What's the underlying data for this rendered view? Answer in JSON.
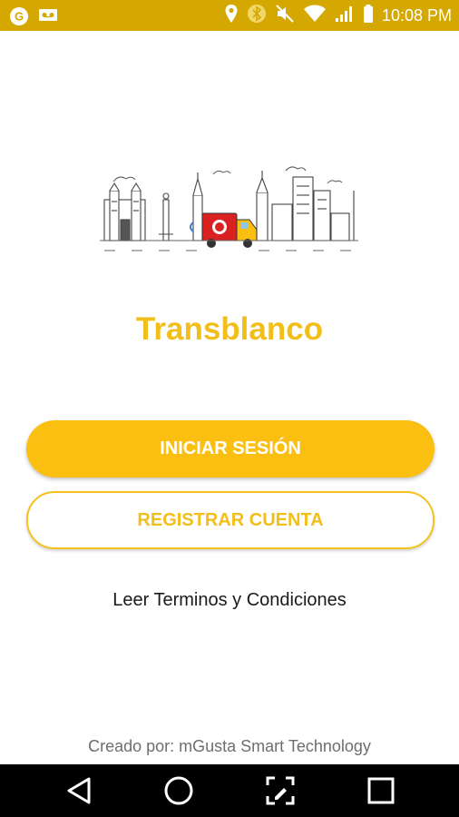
{
  "status_bar": {
    "time": "10:08 PM",
    "icons": [
      "g-app-icon",
      "voicemail-icon",
      "location-icon",
      "bluetooth-icon",
      "mute-icon",
      "wifi-icon",
      "signal-icon",
      "battery-icon"
    ]
  },
  "app": {
    "title": "Transblanco",
    "accent_color": "#fbbf12"
  },
  "actions": {
    "login_label": "INICIAR SESIÓN",
    "register_label": "REGISTRAR CUENTA",
    "terms_label": "Leer Terminos y Condiciones"
  },
  "footer": {
    "credit": "Creado por: mGusta Smart Technology"
  },
  "nav_bar": {
    "icons": [
      "back-icon",
      "home-icon",
      "screenshot-icon",
      "recents-icon"
    ]
  }
}
